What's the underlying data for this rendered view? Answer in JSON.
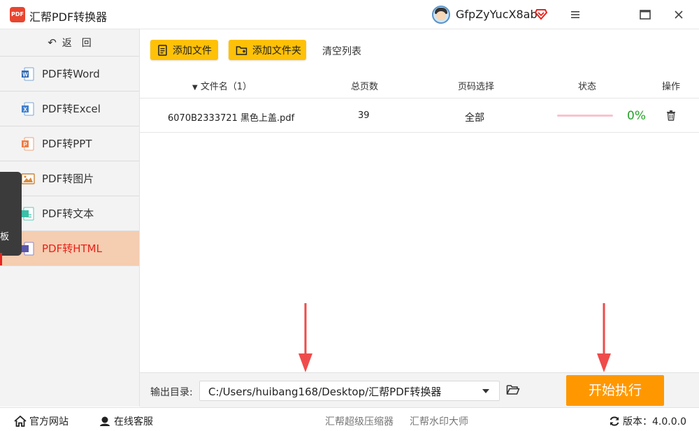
{
  "app": {
    "title": "汇帮PDF转换器",
    "logo_text": "PDF"
  },
  "user": {
    "name": "GfpZyYucX8ab"
  },
  "sidebar": {
    "back_label": "返　回",
    "items": [
      {
        "label": "PDF转Word",
        "icon": "word-icon",
        "active": false
      },
      {
        "label": "PDF转Excel",
        "icon": "excel-icon",
        "active": false
      },
      {
        "label": "PDF转PPT",
        "icon": "ppt-icon",
        "active": false
      },
      {
        "label": "PDF转图片",
        "icon": "image-icon",
        "active": false
      },
      {
        "label": "PDF转文本",
        "icon": "text-icon",
        "active": false
      },
      {
        "label": "PDF转HTML",
        "icon": "html-icon",
        "active": true
      }
    ],
    "overlay_tab_text": "板"
  },
  "toolbar": {
    "add_file": "添加文件",
    "add_folder": "添加文件夹",
    "clear_list": "清空列表"
  },
  "table": {
    "columns": [
      "文件名（1）",
      "总页数",
      "页码选择",
      "状态",
      "操作"
    ],
    "rows": [
      {
        "filename": "6070B2333721 黑色上盖.pdf",
        "pages": "39",
        "page_selection": "全部",
        "progress": 0,
        "status": "0%"
      }
    ]
  },
  "output": {
    "label": "输出目录:",
    "path": "C:/Users/huibang168/Desktop/汇帮PDF转换器",
    "start_button": "开始执行"
  },
  "footer": {
    "website": "官方网站",
    "support": "在线客服",
    "link1": "汇帮超级压缩器",
    "link2": "汇帮水印大师",
    "version": "版本：4.0.0.0"
  },
  "colors": {
    "accent_yellow": "#ffc107",
    "start_orange": "#ff9800",
    "active_bg": "#f5cdb0",
    "active_text": "#e8211b",
    "status_green": "#25a22a",
    "arrow_red": "#ef4b4b"
  }
}
